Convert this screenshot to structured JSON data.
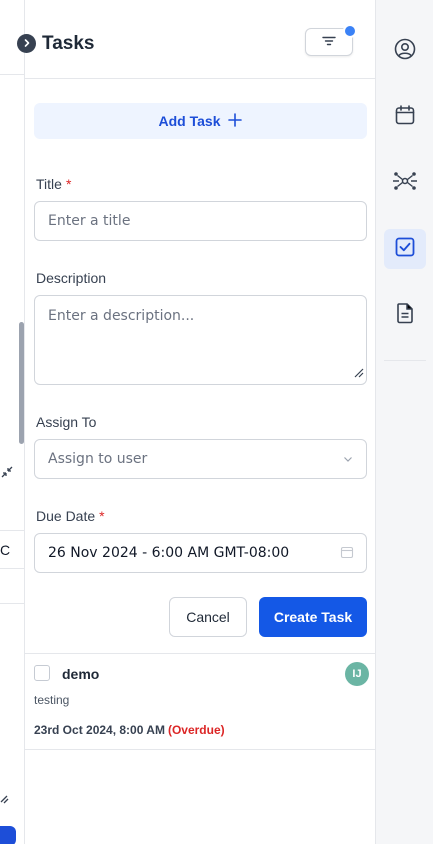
{
  "header": {
    "title": "Tasks",
    "collapse_icon": "chevron-right-icon",
    "filter_icon": "filter-lines-icon"
  },
  "add_task": {
    "label": "Add Task",
    "icon": "plus-icon"
  },
  "form": {
    "title_label": "Title",
    "required_mark": "*",
    "title_placeholder": "Enter a title",
    "description_label": "Description",
    "description_placeholder": "Enter a description...",
    "assign_label": "Assign To",
    "assign_placeholder": "Assign to user",
    "due_label": "Due Date",
    "due_value": "26 Nov 2024 - 6:00 AM GMT-08:00",
    "cancel_label": "Cancel",
    "create_label": "Create Task"
  },
  "tasks": [
    {
      "title": "demo",
      "description": "testing",
      "due": "23rd Oct 2024, 8:00 AM",
      "status": "(Overdue)",
      "assignee_initials": "IJ"
    }
  ],
  "left_sliver": {
    "cut_text": "C"
  },
  "rail": {
    "items": [
      "user-circle-icon",
      "calendar-icon",
      "network-icon",
      "checkbox-icon",
      "document-icon"
    ],
    "active_index": 3
  },
  "colors": {
    "accent": "#1458e6",
    "accent_soft": "#eef4ff",
    "danger": "#dc2626",
    "avatar": "#6bb5a4",
    "notification_dot": "#3b82f6"
  }
}
